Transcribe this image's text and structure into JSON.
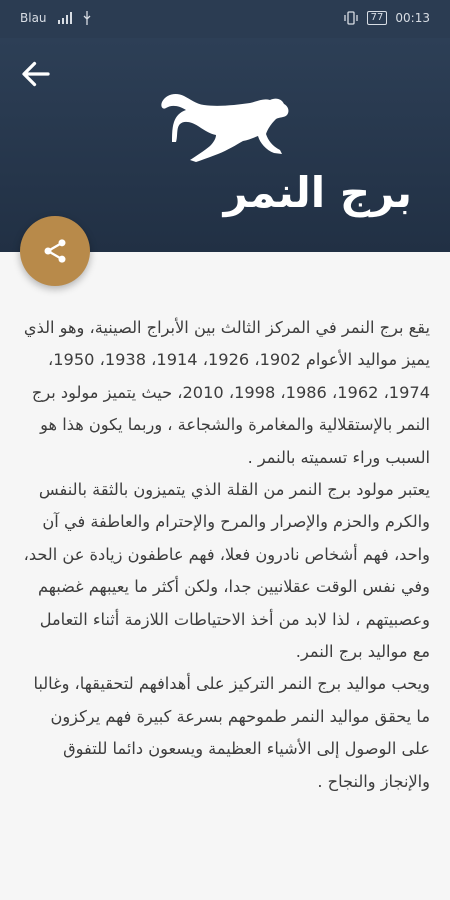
{
  "status_bar": {
    "carrier": "Blau",
    "battery": "77",
    "time": "00:13"
  },
  "header": {
    "title": "برج النمر"
  },
  "colors": {
    "header_bg": "#2b3c52",
    "fab_bg": "#b88a4a",
    "text": "#3d3d3d",
    "page_bg": "#f6f6f6"
  },
  "icons": {
    "back": "arrow-back-icon",
    "share": "share-icon",
    "tiger": "tiger-silhouette-icon"
  },
  "article": {
    "paragraphs": [
      "يقع برج النمر في المركز الثالث بين الأبراج الصينية، وهو الذي يميز مواليد الأعوام 1902، 1926، 1914، 1938، 1950، 1974، 1962، 1986، 1998، 2010، حيث يتميز مولود برج النمر بالإستقلالية والمغامرة والشجاعة ، وربما يكون هذا هو السبب وراء تسميته بالنمر .",
      "يعتبر مولود برج النمر من القلة الذي يتميزون بالثقة بالنفس والكرم والحزم والإصرار والمرح والإحترام والعاطفة في آن واحد، فهم أشخاص نادرون فعلا، فهم عاطفون زيادة عن الحد، وفي نفس الوقت عقلانيين جدا، ولكن أكثر ما يعيبهم غضبهم وعصبيتهم ، لذا لابد من أخذ الاحتياطات اللازمة أثناء التعامل مع مواليد برج النمر.",
      "ويحب مواليد برج النمر التركيز على أهدافهم لتحقيقها، وغالبا ما يحقق مواليد النمر طموحهم بسرعة كبيرة فهم يركزون على الوصول إلى الأشياء العظيمة ويسعون دائما للتفوق والإنجاز والنجاح ."
    ]
  }
}
